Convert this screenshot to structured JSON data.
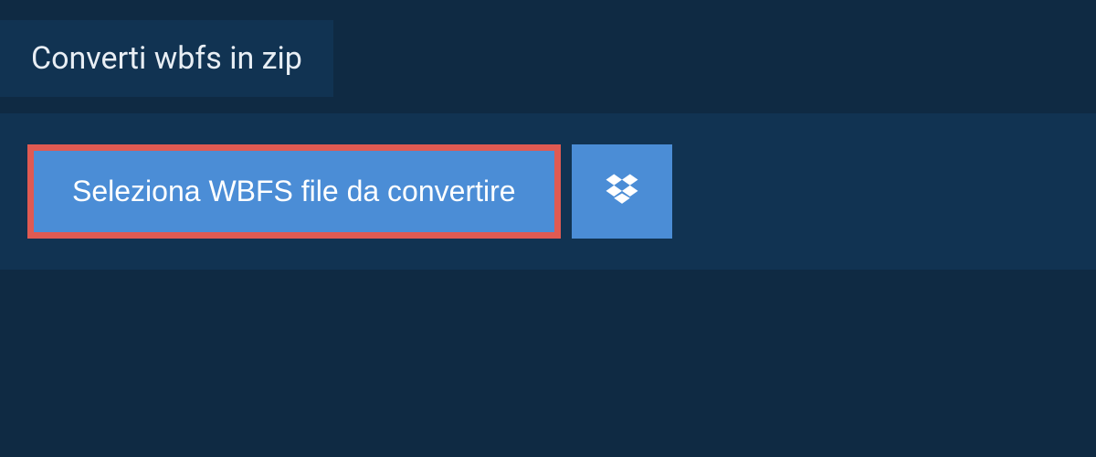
{
  "header": {
    "title": "Converti wbfs in zip"
  },
  "actions": {
    "select_file_label": "Seleziona WBFS file da convertire"
  },
  "colors": {
    "background": "#0f2a43",
    "panel": "#113352",
    "button": "#4b8dd6",
    "highlight_border": "#e05a52",
    "text_light": "#e8eef4",
    "text_white": "#ffffff"
  }
}
